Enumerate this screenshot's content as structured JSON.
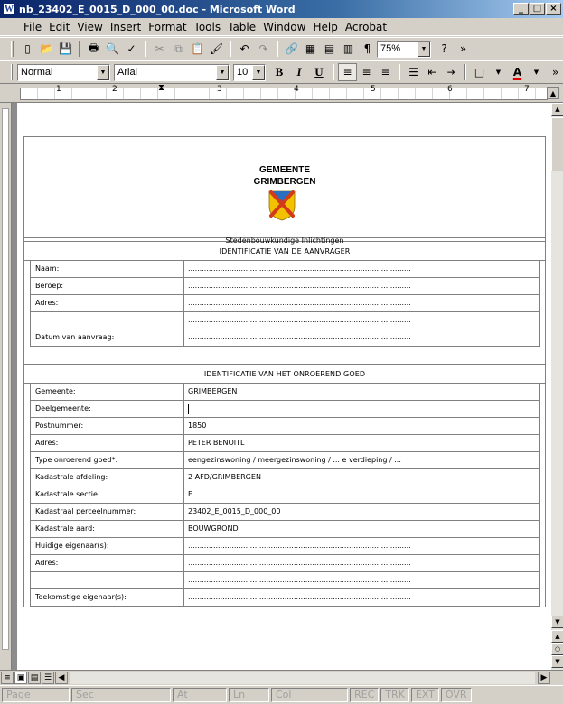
{
  "window": {
    "title": "nb_23402_E_0015_D_000_00.doc - Microsoft Word",
    "icon": "W",
    "buttons": [
      "_",
      "□",
      "×"
    ]
  },
  "menu": [
    "File",
    "Edit",
    "View",
    "Insert",
    "Format",
    "Tools",
    "Table",
    "Window",
    "Help",
    "Acrobat"
  ],
  "toolbar_standard": {
    "buttons": [
      "new-icon",
      "open-icon",
      "save-icon",
      "permission-icon",
      "print-icon",
      "print-preview-icon",
      "spelling-icon",
      "cut-icon",
      "copy-icon",
      "paste-icon",
      "format-painter-icon",
      "undo-icon",
      "redo-icon",
      "hyperlink-icon",
      "tables-borders-icon",
      "insert-table-icon",
      "columns-icon",
      "show-hide-icon",
      "help-icon"
    ],
    "zoom": "75%",
    "glyphs": {
      "new": "▯",
      "open": "📂",
      "save": "💾",
      "print": "🖶",
      "preview": "🔍",
      "spell": "✓",
      "cut": "✂",
      "copy": "⧉",
      "paste": "📋",
      "painter": "🖌",
      "undo": "↶",
      "redo": "↷",
      "link": "🔗",
      "tables": "▦",
      "insert_table": "▤",
      "columns": "▥",
      "pilcrow": "¶",
      "help": "?",
      "more": "»"
    }
  },
  "toolbar_format": {
    "style": "Normal",
    "font": "Arial",
    "size": "10",
    "bold": "B",
    "italic": "I",
    "underline": "U",
    "glyphs": {
      "align_left": "≡",
      "center": "≡",
      "right": "≡",
      "numbering": "☰",
      "decrease_indent": "⇤",
      "increase_indent": "⇥",
      "border": "□",
      "font_color": "A",
      "more": "»"
    }
  },
  "ruler": {
    "numbers": [
      "1",
      "2",
      "3",
      "4",
      "5",
      "6",
      "7"
    ]
  },
  "document": {
    "municipality_line1": "GEMEENTE",
    "municipality_line2": "GRIMBERGEN",
    "crest_caption": "Stedenbouwkundige Inlichtingen",
    "section1_title": "IDENTIFICATIE VAN DE AANVRAGER",
    "section1_rows": [
      {
        "label": "Naam:",
        "value": "................................................................................................."
      },
      {
        "label": "Beroep:",
        "value": "................................................................................................."
      },
      {
        "label": "Adres:",
        "value": "................................................................................................."
      },
      {
        "label": "",
        "value": "................................................................................................."
      },
      {
        "label": "Datum van aanvraag:",
        "value": "................................................................................................."
      }
    ],
    "section2_title": "IDENTIFICATIE VAN HET ONROEREND GOED",
    "section2_rows": [
      {
        "label": "Gemeente:",
        "value": "GRIMBERGEN"
      },
      {
        "label": "Deelgemeente:",
        "value": ""
      },
      {
        "label": "Postnummer:",
        "value": "1850"
      },
      {
        "label": "Adres:",
        "value": "PETER BENOITL"
      },
      {
        "label": "Type onroerend goed*:",
        "value": "eengezinswoning / meergezinswoning / ... e verdieping / ..."
      },
      {
        "label": "Kadastrale afdeling:",
        "value": "2 AFD/GRIMBERGEN"
      },
      {
        "label": "Kadastrale sectie:",
        "value": "E"
      },
      {
        "label": "Kadastraal perceelnummer:",
        "value": "23402_E_0015_D_000_00"
      },
      {
        "label": "Kadastrale aard:",
        "value": "BOUWGROND"
      },
      {
        "label": "Huidige eigenaar(s):",
        "value": "................................................................................................."
      },
      {
        "label": "Adres:",
        "value": "................................................................................................."
      },
      {
        "label": "",
        "value": "................................................................................................."
      },
      {
        "label": "Toekomstige eigenaar(s):",
        "value": "................................................................................................."
      }
    ]
  },
  "status_bar": [
    "Page",
    "Sec",
    "At",
    "Ln",
    "Col",
    "REC",
    "TRK",
    "EXT",
    "OVR"
  ],
  "colors": {
    "title_start": "#0a246a",
    "title_end": "#a6caf0",
    "chrome": "#d4d0c8",
    "crest_yellow": "#f2c200",
    "crest_blue": "#2a6fbf",
    "crest_red": "#d23a1a"
  }
}
